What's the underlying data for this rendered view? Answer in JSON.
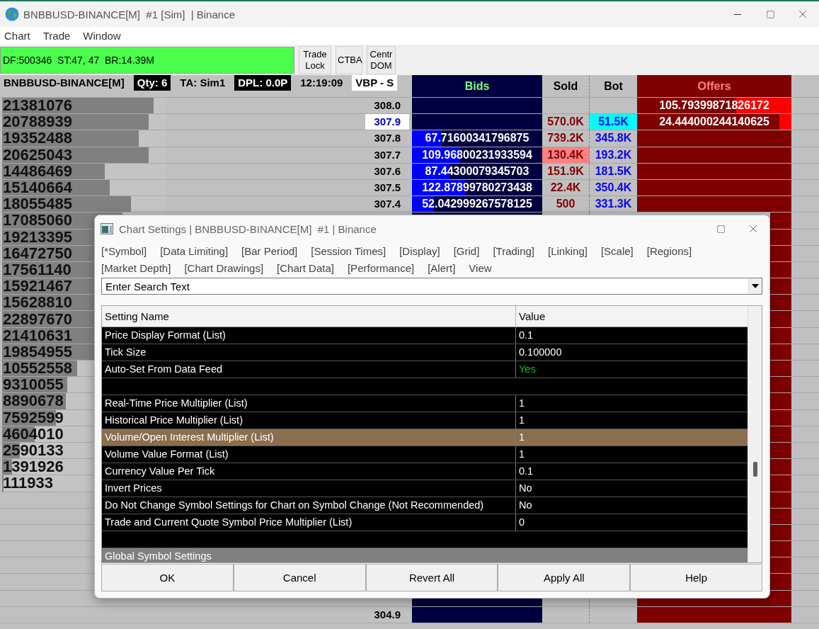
{
  "window": {
    "title": "BNBBUSD-BINANCE[M]  #1 [Sim]  | Binance"
  },
  "menu": [
    "Chart",
    "Trade",
    "Window"
  ],
  "status_box": {
    "text": "DF:500346  ST:47, 47  BR:14.39M"
  },
  "toolbar_buttons": [
    "Trade Lock",
    "CTBA",
    "Centr DOM"
  ],
  "info_bar": [
    {
      "text": "BNBBUSD-BINANCE[M]",
      "kind": "plain"
    },
    {
      "text": "Qty: 6",
      "kind": "inverse"
    },
    {
      "text": "TA: Sim1",
      "kind": "plain"
    },
    {
      "text": "DPL: 0.0P",
      "kind": "inverse"
    },
    {
      "text": "12:19:09",
      "kind": "plain"
    },
    {
      "text": "VBP - S",
      "kind": "light"
    }
  ],
  "ladder": {
    "columns": [
      {
        "label": "Bids",
        "kind": "bids"
      },
      {
        "label": "Sold",
        "kind": "sold"
      },
      {
        "label": "Bot",
        "kind": "bot"
      },
      {
        "label": "Offers",
        "kind": "offers"
      }
    ],
    "rows": [
      {
        "price": "308.0",
        "last_trade": false,
        "volume": {
          "text": "21381076",
          "level": 0.93
        },
        "offer": {
          "text": "105.79399871826172",
          "level": 0.36
        }
      },
      {
        "price": "307.9",
        "last_trade": true,
        "volume": {
          "text": "20788939",
          "level": 0.9
        },
        "sold": {
          "text": "570.0K",
          "highlighted": false
        },
        "bot": {
          "text": "51.5K",
          "highlighted": true
        },
        "offer": {
          "text": "24.444000244140625",
          "level": 0.08
        }
      },
      {
        "price": "307.8",
        "last_trade": false,
        "volume": {
          "text": "19352488",
          "level": 0.84
        },
        "bid": {
          "text": "67.71600341796875",
          "level": 0.23
        },
        "sold": {
          "text": "739.2K",
          "highlighted": false
        },
        "bot": {
          "text": "345.8K",
          "highlighted": false
        }
      },
      {
        "price": "307.7",
        "last_trade": false,
        "volume": {
          "text": "20625043",
          "level": 0.9
        },
        "bid": {
          "text": "109.96800231933594",
          "level": 0.37
        },
        "sold": {
          "text": "130.4K",
          "highlighted": true
        },
        "bot": {
          "text": "193.2K",
          "highlighted": false
        }
      },
      {
        "price": "307.6",
        "last_trade": false,
        "volume": {
          "text": "14486469",
          "level": 0.63
        },
        "bid": {
          "text": "87.44300079345703",
          "level": 0.29
        },
        "sold": {
          "text": "151.9K",
          "highlighted": false
        },
        "bot": {
          "text": "181.5K",
          "highlighted": false
        }
      },
      {
        "price": "307.5",
        "last_trade": false,
        "volume": {
          "text": "15140664",
          "level": 0.66
        },
        "bid": {
          "text": "122.87899780273438",
          "level": 0.41
        },
        "sold": {
          "text": "22.4K",
          "highlighted": false
        },
        "bot": {
          "text": "350.4K",
          "highlighted": false
        }
      },
      {
        "price": "307.4",
        "last_trade": false,
        "volume": {
          "text": "18055485",
          "level": 0.79
        },
        "bid": {
          "text": "52.042999267578125",
          "level": 0.17
        },
        "sold": {
          "text": "500",
          "highlighted": false
        },
        "bot": {
          "text": "331.3K",
          "highlighted": false
        }
      },
      {
        "volume": {
          "text": "17085060",
          "level": 0.74
        }
      },
      {
        "volume": {
          "text": "19213395",
          "level": 0.84
        }
      },
      {
        "volume": {
          "text": "16472750",
          "level": 0.72
        }
      },
      {
        "volume": {
          "text": "17561140",
          "level": 0.76
        }
      },
      {
        "volume": {
          "text": "15921467",
          "level": 0.69
        }
      },
      {
        "volume": {
          "text": "15628810",
          "level": 0.68
        }
      },
      {
        "volume": {
          "text": "22897670",
          "level": 1.0
        }
      },
      {
        "volume": {
          "text": "21410631",
          "level": 0.93
        }
      },
      {
        "volume": {
          "text": "19854955",
          "level": 0.86
        }
      },
      {
        "volume": {
          "text": "10552558",
          "level": 0.46
        }
      },
      {
        "volume": {
          "text": "9310055",
          "level": 0.4
        }
      },
      {
        "volume": {
          "text": "8890678",
          "level": 0.39
        }
      },
      {
        "volume": {
          "text": "7592599",
          "level": 0.33
        }
      },
      {
        "volume": {
          "text": "4604010",
          "level": 0.2
        }
      },
      {
        "volume": {
          "text": "2590133",
          "level": 0.11
        }
      },
      {
        "volume": {
          "text": "1391926",
          "level": 0.06
        }
      },
      {
        "volume": {
          "text": "111933",
          "level": 0.01
        }
      },
      {},
      {},
      {},
      {},
      {},
      {},
      {},
      {
        "price": "304.9",
        "last_trade": false
      }
    ]
  },
  "dialog": {
    "title": "Chart Settings | BNBBUSD-BINANCE[M]  #1 | Binance",
    "tab_rows": [
      [
        "[*Symbol]",
        "[Data Limiting]",
        "[Bar Period]",
        "[Session Times]",
        "[Display]",
        "[Grid]",
        "[Trading]",
        "[Linking]",
        "[Scale]",
        "[Regions]"
      ],
      [
        "[Market Depth]",
        "[Chart Drawings]",
        "[Chart Data]",
        "[Performance]",
        "[Alert]",
        "View"
      ]
    ],
    "search": {
      "placeholder": "Enter Search Text"
    },
    "table": {
      "columns": [
        "Setting Name",
        "Value"
      ],
      "rows": [
        {
          "kind": "setting",
          "name": "Price Display Format (List)",
          "value": "0.1",
          "selected": false
        },
        {
          "kind": "setting",
          "name": "Tick Size",
          "value": "0.100000",
          "selected": false
        },
        {
          "kind": "setting",
          "name": "Auto-Set From Data Feed",
          "value": "Yes",
          "selected": false,
          "color": "#00d000"
        },
        {
          "kind": "blank"
        },
        {
          "kind": "setting",
          "name": "Real-Time Price Multiplier (List)",
          "value": "1",
          "selected": false
        },
        {
          "kind": "setting",
          "name": "Historical Price Multiplier (List)",
          "value": "1",
          "selected": false
        },
        {
          "kind": "setting",
          "name": "Volume/Open Interest Multiplier (List)",
          "value": "1",
          "selected": true
        },
        {
          "kind": "setting",
          "name": "Volume Value Format (List)",
          "value": "1",
          "selected": false
        },
        {
          "kind": "setting",
          "name": "Currency Value Per Tick",
          "value": "0.1",
          "selected": false
        },
        {
          "kind": "setting",
          "name": "Invert Prices",
          "value": "No",
          "selected": false
        },
        {
          "kind": "setting",
          "name": "Do Not Change Symbol Settings for Chart on Symbol Change (Not Recommended)",
          "value": "No",
          "selected": false
        },
        {
          "kind": "setting",
          "name": "Trade and Current Quote Symbol Price Multiplier (List)",
          "value": "0",
          "selected": false
        },
        {
          "kind": "blank"
        },
        {
          "kind": "section",
          "name": "Global Symbol Settings"
        }
      ]
    },
    "buttons": [
      "OK",
      "Cancel",
      "Revert All",
      "Apply All",
      "Help"
    ]
  }
}
